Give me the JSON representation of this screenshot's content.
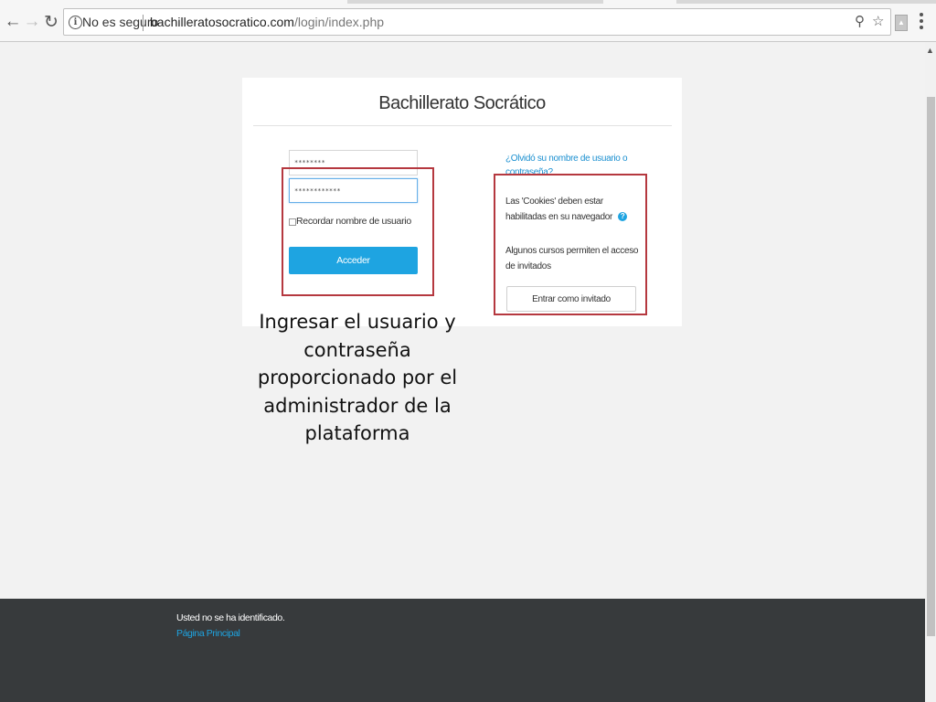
{
  "browser": {
    "security_label": "No es seguro",
    "url_domain": "bachilleratosocratico.com",
    "url_path": "/login/index.php"
  },
  "login": {
    "site_name": "Bachillerato Socrático",
    "username_value": "********",
    "password_value": "************",
    "remember_label": "Recordar nombre de usuario",
    "login_button": "Acceder",
    "forgot_link": "¿Olvidó su nombre de usuario o contraseña?",
    "cookies_text": "Las 'Cookies' deben estar habilitadas en su navegador",
    "guest_text": "Algunos cursos permiten el acceso de invitados",
    "guest_button": "Entrar como invitado"
  },
  "annotation": {
    "callout_text": "Ingresar el usuario y contraseña proporcionado por el administrador de la plataforma",
    "highlight_color": "#b5383f"
  },
  "footer": {
    "status_text": "Usted no se ha identificado.",
    "home_link": "Página Principal"
  },
  "colors": {
    "accent": "#1ea4e1",
    "footer_bg": "#373a3c",
    "page_bg": "#f2f2f2"
  }
}
